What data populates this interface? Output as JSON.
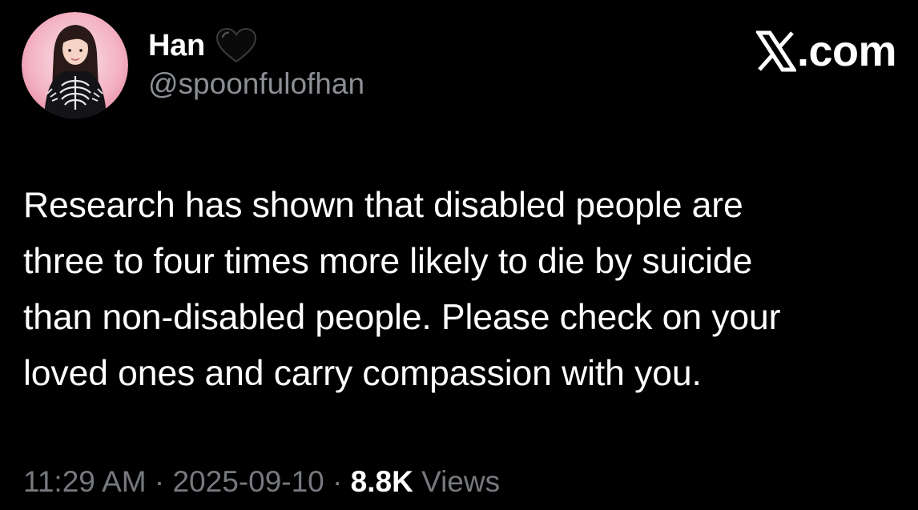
{
  "author": {
    "display_name": "Han",
    "handle": "@spoonfulofhan",
    "badge_icon": "black-heart-icon"
  },
  "brand": {
    "logo_icon": "x-logo-icon",
    "text": ".com"
  },
  "tweet": {
    "lines": [
      "Research has shown that disabled people are",
      "three to four times more likely to die by suicide",
      "than non-disabled people. Please check on your",
      "loved ones and carry compassion with you."
    ]
  },
  "meta": {
    "time": "11:29 AM",
    "separator": " · ",
    "date": "2025-09-10",
    "views_count": "8.8K",
    "views_label": " Views"
  },
  "colors": {
    "background": "#000000",
    "primary_text": "#ffffff",
    "secondary_text": "#8b8f94",
    "avatar_ring": "#f2b6c6"
  }
}
